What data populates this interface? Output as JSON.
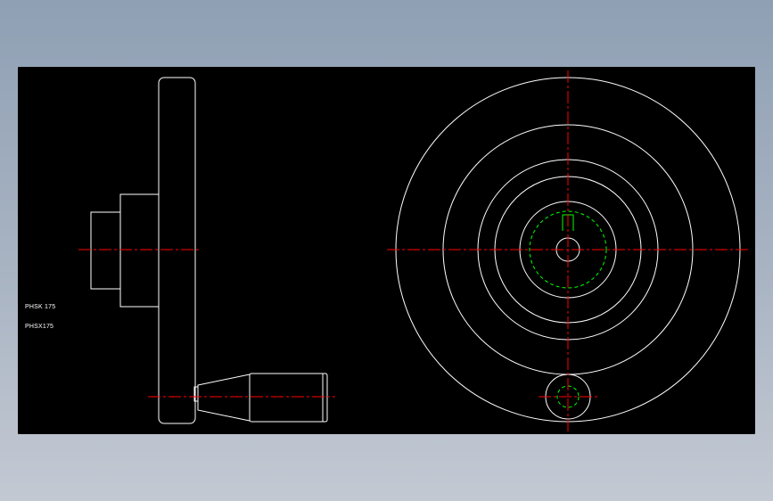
{
  "drawing": {
    "labels": [
      "PHSK 175",
      "PHSX175"
    ],
    "colors": {
      "background": "#000000",
      "outline": "#ffffff",
      "centerline": "#ff0000",
      "hidden": "#00ff00",
      "frame": "#8fa0b4"
    },
    "views": [
      "side-view",
      "front-view"
    ]
  }
}
